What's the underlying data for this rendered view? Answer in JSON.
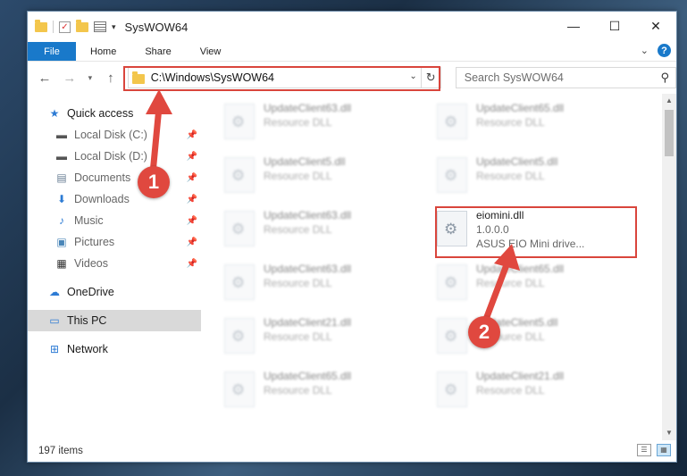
{
  "window": {
    "title": "SysWOW64",
    "minimize_glyph": "—",
    "maximize_glyph": "☐",
    "close_glyph": "✕"
  },
  "ribbon": {
    "file": "File",
    "tabs": [
      "Home",
      "Share",
      "View"
    ],
    "help_glyph": "?"
  },
  "nav": {
    "address": "C:\\Windows\\SysWOW64",
    "search_placeholder": "Search SysWOW64"
  },
  "sidebar": {
    "quick_access": "Quick access",
    "pinned": [
      "Local Disk (C:)",
      "Local Disk (D:)",
      "Documents",
      "Downloads",
      "Music",
      "Pictures",
      "Videos"
    ],
    "onedrive": "OneDrive",
    "thispc": "This PC",
    "network": "Network"
  },
  "files": {
    "col1": [
      {
        "name": "UpdateClient63.dll",
        "sub": "Resource DLL"
      },
      {
        "name": "UpdateClient5.dll",
        "sub": "Resource DLL"
      },
      {
        "name": "UpdateClient63.dll",
        "sub": "Resource DLL"
      },
      {
        "name": "UpdateClient63.dll",
        "sub": "Resource DLL"
      },
      {
        "name": "UpdateClient21.dll",
        "sub": "Resource DLL"
      },
      {
        "name": "UpdateClient65.dll",
        "sub": "Resource DLL"
      }
    ],
    "col2": [
      {
        "name": "UpdateClient65.dll",
        "sub": "Resource DLL"
      },
      {
        "name": "UpdateClient5.dll",
        "sub": "Resource DLL"
      },
      {
        "name": "eiomini.dll",
        "sub": "1.0.0.0",
        "sub2": "ASUS EIO Mini drive..."
      },
      {
        "name": "UpdateClient65.dll",
        "sub": "Resource DLL"
      },
      {
        "name": "UpdateClient5.dll",
        "sub": "Resource DLL"
      },
      {
        "name": "UpdateClient21.dll",
        "sub": "Resource DLL"
      }
    ]
  },
  "status": {
    "items": "197 items"
  },
  "annotations": {
    "badge1": "1",
    "badge2": "2",
    "color": "#e0483f"
  }
}
